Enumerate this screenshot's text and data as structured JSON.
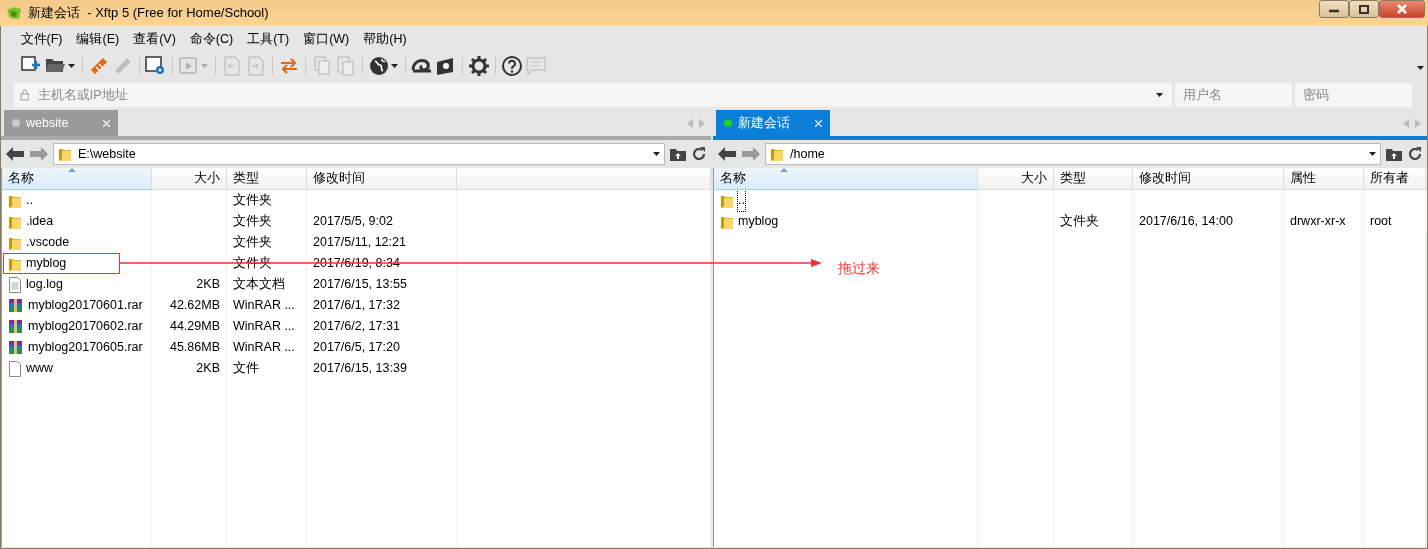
{
  "window": {
    "title": "新建会话  - Xftp 5 (Free for Home/School)"
  },
  "menu": [
    "文件(F)",
    "编辑(E)",
    "查看(V)",
    "命令(C)",
    "工具(T)",
    "窗口(W)",
    "帮助(H)"
  ],
  "toolbar": [
    {
      "kind": "new-session",
      "disabled": false,
      "dropdown": false
    },
    {
      "kind": "open-folder",
      "disabled": false,
      "dropdown": true
    },
    {
      "kind": "separator"
    },
    {
      "kind": "connect",
      "disabled": false,
      "dropdown": false
    },
    {
      "kind": "disconnect",
      "disabled": true,
      "dropdown": false
    },
    {
      "kind": "separator"
    },
    {
      "kind": "properties",
      "disabled": false,
      "dropdown": false
    },
    {
      "kind": "separator"
    },
    {
      "kind": "play",
      "disabled": true,
      "dropdown": true
    },
    {
      "kind": "separator"
    },
    {
      "kind": "page-left",
      "disabled": true,
      "dropdown": false
    },
    {
      "kind": "page-right",
      "disabled": true,
      "dropdown": false
    },
    {
      "kind": "separator"
    },
    {
      "kind": "transfer",
      "disabled": false,
      "dropdown": false
    },
    {
      "kind": "separator"
    },
    {
      "kind": "copy",
      "disabled": true,
      "dropdown": false
    },
    {
      "kind": "paste",
      "disabled": true,
      "dropdown": false
    },
    {
      "kind": "separator"
    },
    {
      "kind": "globe",
      "disabled": false,
      "dropdown": true
    },
    {
      "kind": "separator"
    },
    {
      "kind": "shell",
      "disabled": false,
      "dropdown": false
    },
    {
      "kind": "manager",
      "disabled": false,
      "dropdown": false
    },
    {
      "kind": "separator"
    },
    {
      "kind": "settings",
      "disabled": false,
      "dropdown": false
    },
    {
      "kind": "separator"
    },
    {
      "kind": "help",
      "disabled": false,
      "dropdown": false
    },
    {
      "kind": "chat",
      "disabled": true,
      "dropdown": false
    }
  ],
  "address_bar": {
    "host_placeholder": "主机名或IP地址",
    "username_placeholder": "用户名",
    "password_placeholder": "密码"
  },
  "panes": [
    {
      "tab": {
        "label": "website",
        "selected": false,
        "color": "#c8c8c8"
      },
      "path": "E:\\website",
      "columns": [
        {
          "label": "名称",
          "sorted": true
        },
        {
          "label": "大小",
          "sorted": false
        },
        {
          "label": "类型",
          "sorted": false
        },
        {
          "label": "修改时间",
          "sorted": false
        }
      ],
      "rows": [
        {
          "kind": "folder",
          "focused": false,
          "cells": [
            "..",
            "",
            "文件夹",
            ""
          ]
        },
        {
          "kind": "folder",
          "focused": false,
          "cells": [
            ".idea",
            "",
            "文件夹",
            "2017/5/5, 9:02"
          ]
        },
        {
          "kind": "folder",
          "focused": false,
          "cells": [
            ".vscode",
            "",
            "文件夹",
            "2017/5/11, 12:21"
          ]
        },
        {
          "kind": "folder",
          "focused": false,
          "cells": [
            "myblog",
            "",
            "文件夹",
            "2017/6/19, 8:34"
          ]
        },
        {
          "kind": "text",
          "focused": false,
          "cells": [
            "log.log",
            "2KB",
            "文本文档",
            "2017/6/15, 13:55"
          ]
        },
        {
          "kind": "archive",
          "focused": false,
          "cells": [
            "myblog20170601.rar",
            "42.62MB",
            "WinRAR ...",
            "2017/6/1, 17:32"
          ]
        },
        {
          "kind": "archive",
          "focused": false,
          "cells": [
            "myblog20170602.rar",
            "44.29MB",
            "WinRAR ...",
            "2017/6/2, 17:31"
          ]
        },
        {
          "kind": "archive",
          "focused": false,
          "cells": [
            "myblog20170605.rar",
            "45.86MB",
            "WinRAR ...",
            "2017/6/5, 17:20"
          ]
        },
        {
          "kind": "file",
          "focused": false,
          "cells": [
            "www",
            "2KB",
            "文件",
            "2017/6/15, 13:39"
          ]
        }
      ]
    },
    {
      "tab": {
        "label": "新建会话",
        "selected": true,
        "color": "#22cc22"
      },
      "path": "/home",
      "columns": [
        {
          "label": "名称",
          "sorted": true
        },
        {
          "label": "大小",
          "sorted": false
        },
        {
          "label": "类型",
          "sorted": false
        },
        {
          "label": "修改时间",
          "sorted": false
        },
        {
          "label": "属性",
          "sorted": false
        },
        {
          "label": "所有者",
          "sorted": false
        }
      ],
      "rows": [
        {
          "kind": "folder",
          "focused": true,
          "cells": [
            "..",
            "",
            "",
            "",
            "",
            ""
          ]
        },
        {
          "kind": "folder",
          "focused": false,
          "cells": [
            "myblog",
            "",
            "文件夹",
            "2017/6/16, 14:00",
            "drwxr-xr-x",
            "root"
          ]
        }
      ]
    }
  ],
  "annotation": {
    "label": "拖过来"
  }
}
